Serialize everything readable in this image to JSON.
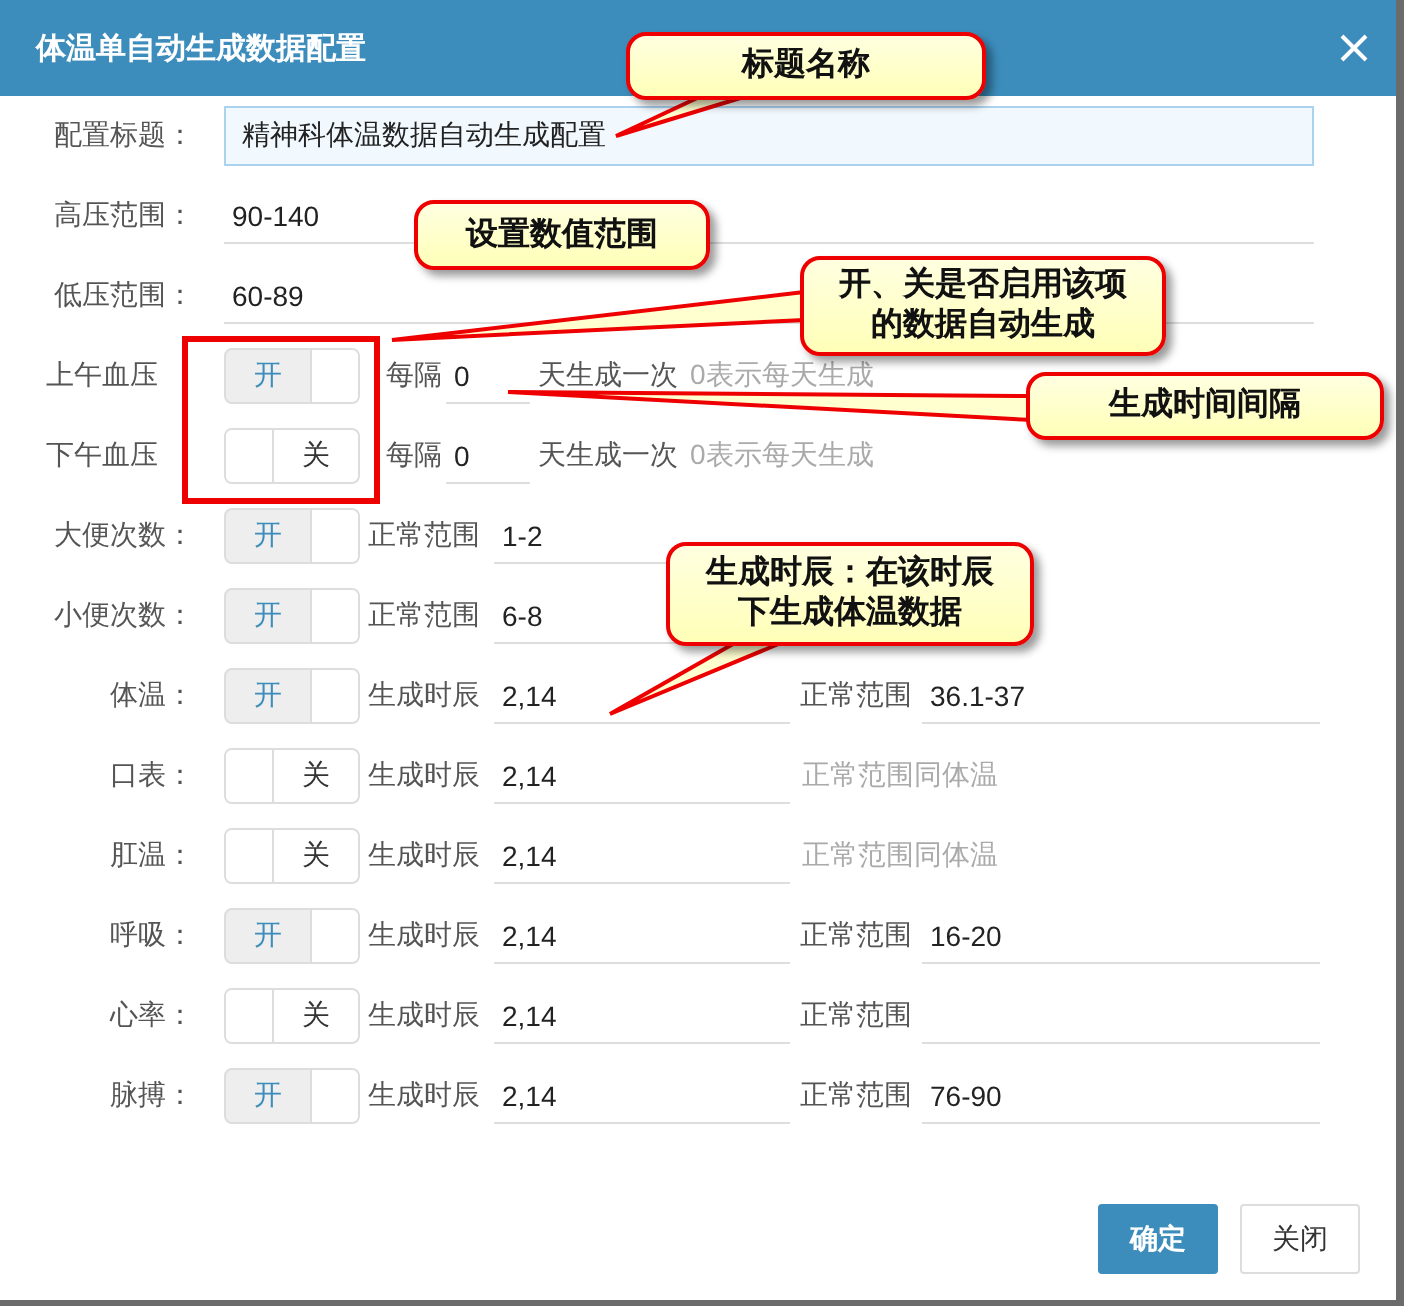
{
  "dialog": {
    "title": "体温单自动生成数据配置"
  },
  "rows": [
    {
      "kind": "title",
      "label": "配置标题：",
      "value": "精神科体温数据自动生成配置"
    },
    {
      "kind": "value",
      "label": "高压范围：",
      "value": "90-140"
    },
    {
      "kind": "value",
      "label": "低压范围：",
      "value": "60-89"
    },
    {
      "kind": "interval",
      "label": "上午血压",
      "toggle": {
        "on": true,
        "text": "开"
      },
      "prefix": "每隔",
      "value": "0",
      "suffix": "天生成一次",
      "hint": "0表示每天生成"
    },
    {
      "kind": "interval",
      "label": "下午血压",
      "toggle": {
        "on": false,
        "text": "关"
      },
      "prefix": "每隔",
      "value": "0",
      "suffix": "天生成一次",
      "hint": "0表示每天生成"
    },
    {
      "kind": "count",
      "label": "大便次数：",
      "toggle": {
        "on": true,
        "text": "开"
      },
      "range_label": "正常范围",
      "range": "1-2"
    },
    {
      "kind": "count",
      "label": "小便次数：",
      "toggle": {
        "on": true,
        "text": "开"
      },
      "range_label": "正常范围",
      "range": "6-8"
    },
    {
      "kind": "timed",
      "label": "体温：",
      "toggle": {
        "on": true,
        "text": "开"
      },
      "time_label": "生成时辰",
      "time": "2,14",
      "range_label": "正常范围",
      "range": "36.1-37"
    },
    {
      "kind": "timed",
      "label": "口表：",
      "toggle": {
        "on": false,
        "text": "关"
      },
      "time_label": "生成时辰",
      "time": "2,14",
      "note": "正常范围同体温"
    },
    {
      "kind": "timed",
      "label": "肛温：",
      "toggle": {
        "on": false,
        "text": "关"
      },
      "time_label": "生成时辰",
      "time": "2,14",
      "note": "正常范围同体温"
    },
    {
      "kind": "timed",
      "label": "呼吸：",
      "toggle": {
        "on": true,
        "text": "开"
      },
      "time_label": "生成时辰",
      "time": "2,14",
      "range_label": "正常范围",
      "range": "16-20"
    },
    {
      "kind": "timed",
      "label": "心率：",
      "toggle": {
        "on": false,
        "text": "关"
      },
      "time_label": "生成时辰",
      "time": "2,14",
      "range_label": "正常范围"
    },
    {
      "kind": "timed",
      "label": "脉搏：",
      "toggle": {
        "on": true,
        "text": "开"
      },
      "time_label": "生成时辰",
      "time": "2,14",
      "range_label": "正常范围",
      "range": "76-90"
    }
  ],
  "buttons": [
    {
      "text": "确定",
      "primary": true
    },
    {
      "text": "关闭",
      "primary": false
    }
  ],
  "callouts": [
    {
      "lines": [
        "标题名称"
      ]
    },
    {
      "lines": [
        "设置数值范围"
      ]
    },
    {
      "lines": [
        "开、关是否启用该项",
        "的数据自动生成"
      ]
    },
    {
      "lines": [
        "生成时间间隔"
      ]
    },
    {
      "lines": [
        "生成时辰：在该时辰",
        "下生成体温数据"
      ]
    }
  ]
}
